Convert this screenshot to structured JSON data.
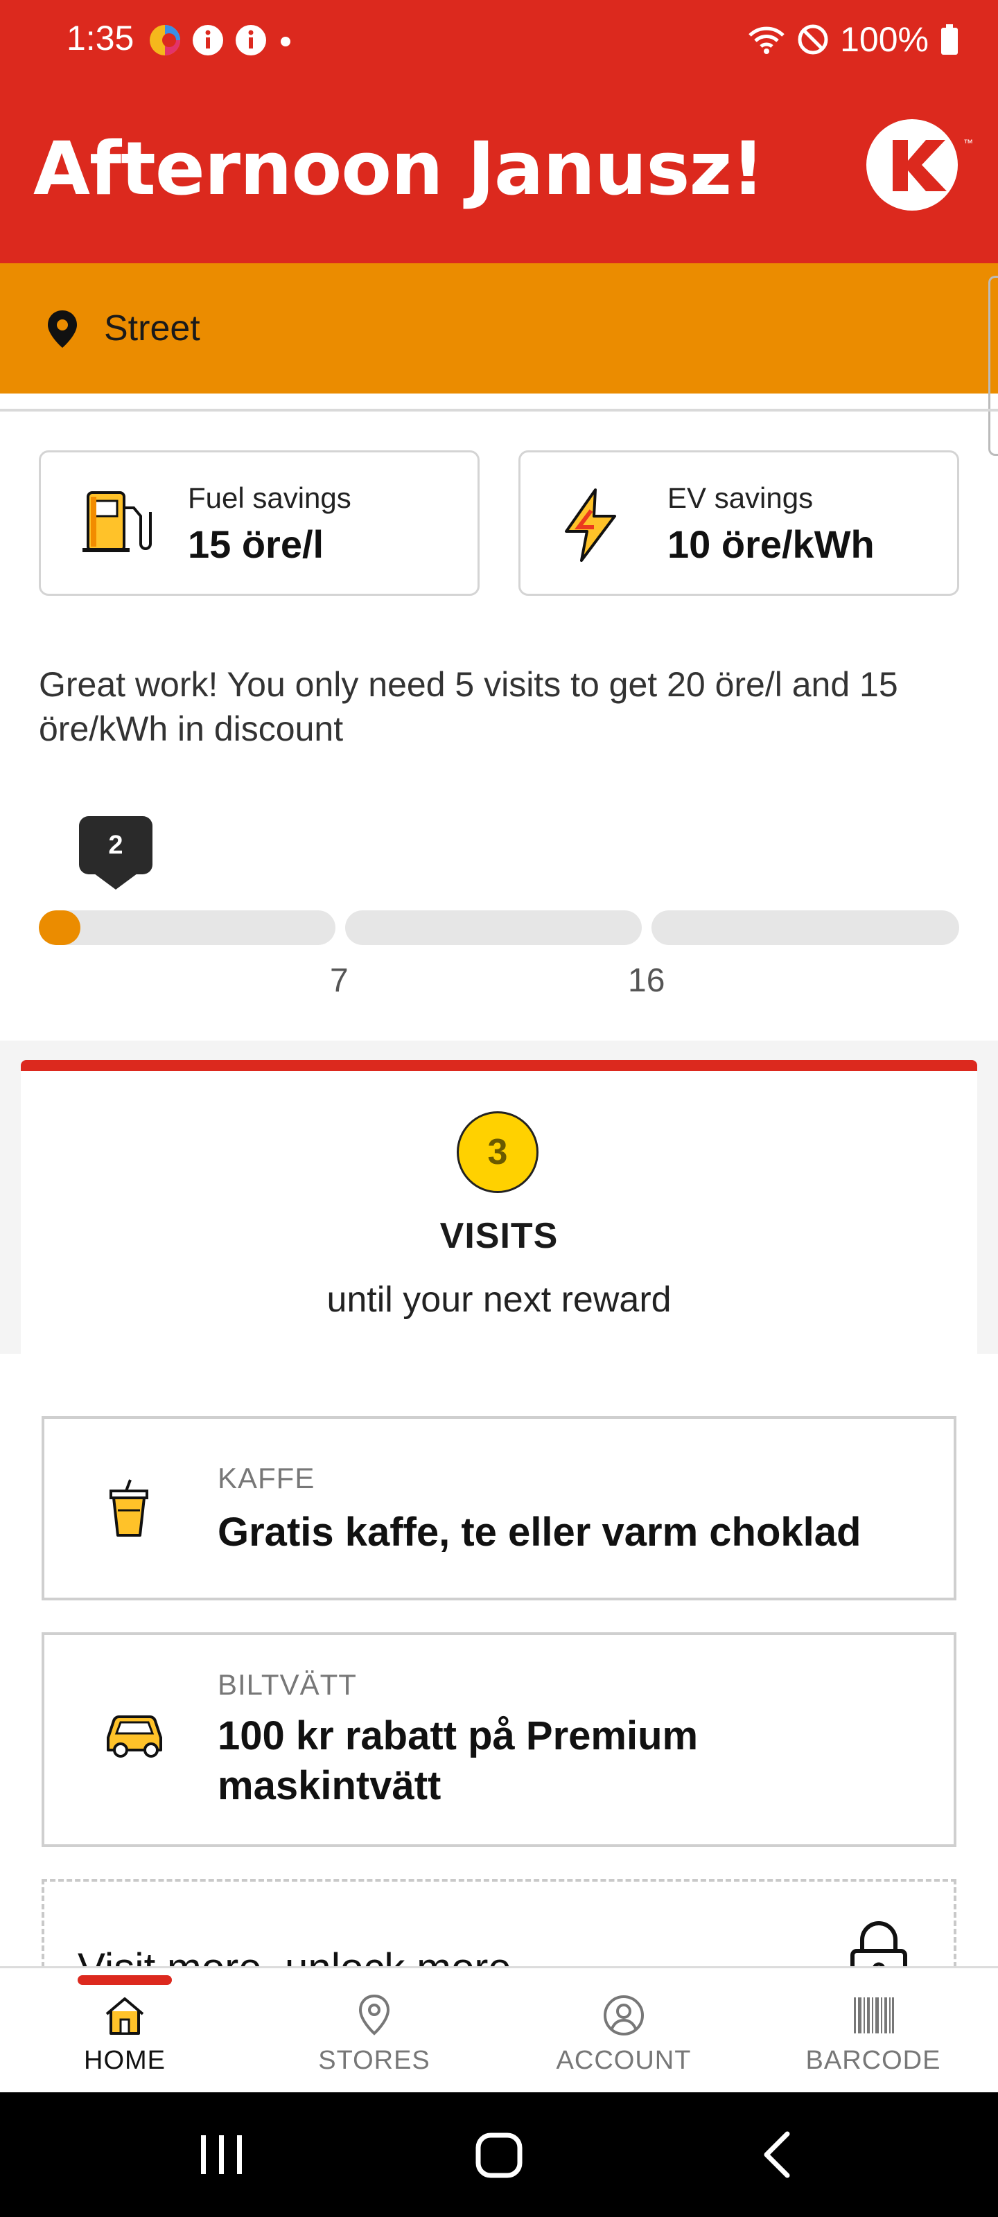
{
  "status_bar": {
    "time": "1:35",
    "battery": "100%"
  },
  "header": {
    "greeting": "Afternoon Janusz!",
    "logo_icon": "circle-k-logo"
  },
  "location": {
    "label": "Street"
  },
  "savings": [
    {
      "label": "Fuel savings",
      "value": "15 öre/l",
      "icon": "fuel-pump-icon"
    },
    {
      "label": "EV savings",
      "value": "10 öre/kWh",
      "icon": "lightning-icon"
    }
  ],
  "progress": {
    "message": "Great work! You only need 5 visits to get 20 öre/l and 15 öre/kWh in discount",
    "current_visits": "2",
    "ticks": [
      "7",
      "16"
    ],
    "segments": [
      {
        "fill_fraction": 0.14
      },
      {
        "fill_fraction": 0
      },
      {
        "fill_fraction": 0
      }
    ],
    "colors": {
      "fill": "#eb8c00",
      "track": "#e6e6e6"
    }
  },
  "visits": {
    "count": "3",
    "title": "VISITS",
    "subtitle": "until your next reward"
  },
  "rewards": [
    {
      "category": "KAFFE",
      "title": "Gratis kaffe, te eller varm choklad",
      "icon": "coffee-cup-icon"
    },
    {
      "category": "BILTVÄTT",
      "title": "100 kr rabatt på Premium maskintvätt",
      "icon": "car-icon"
    }
  ],
  "unlock": {
    "text": "Visit more, unlock more",
    "icon": "lock-icon"
  },
  "bottom_nav": [
    {
      "label": "HOME",
      "icon": "home-icon",
      "active": true
    },
    {
      "label": "STORES",
      "icon": "location-pin-icon",
      "active": false
    },
    {
      "label": "ACCOUNT",
      "icon": "account-icon",
      "active": false
    },
    {
      "label": "BARCODE",
      "icon": "barcode-icon",
      "active": false
    }
  ],
  "theme": {
    "brand_red": "#dc291e",
    "brand_orange": "#eb8c00",
    "visit_yellow": "#ffd100"
  }
}
